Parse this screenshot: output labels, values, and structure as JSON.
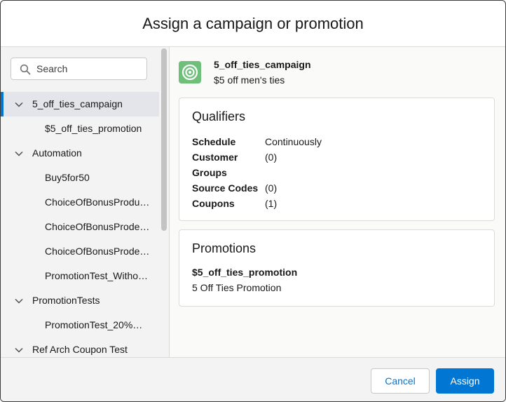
{
  "dialog": {
    "title": "Assign a campaign or promotion"
  },
  "search": {
    "placeholder": "Search"
  },
  "tree": {
    "items": [
      {
        "label": "5_off_ties_campaign",
        "level": 0,
        "expanded": true,
        "selected": true
      },
      {
        "label": "$5_off_ties_promotion",
        "level": 1
      },
      {
        "label": "Automation",
        "level": 0,
        "expanded": true
      },
      {
        "label": "Buy5for50",
        "level": 1
      },
      {
        "label": "ChoiceOfBonusProdu…",
        "level": 1
      },
      {
        "label": "ChoiceOfBonusProde…",
        "level": 1
      },
      {
        "label": "ChoiceOfBonusProde…",
        "level": 1
      },
      {
        "label": "PromotionTest_Witho…",
        "level": 1
      },
      {
        "label": "PromotionTests",
        "level": 0,
        "expanded": true
      },
      {
        "label": "PromotionTest_20%…",
        "level": 1
      },
      {
        "label": "Ref Arch Coupon Test",
        "level": 0,
        "expanded": true
      }
    ]
  },
  "detail": {
    "campaign_name": "5_off_ties_campaign",
    "campaign_description": "$5 off men's ties",
    "campaign_icon": "target-icon",
    "qualifiers": {
      "title": "Qualifiers",
      "rows": [
        {
          "key": "Schedule",
          "value": "Continuously"
        },
        {
          "key": "Customer",
          "value": "(0)"
        },
        {
          "key": "Groups",
          "value": ""
        },
        {
          "key": "Source Codes",
          "value": "(0)"
        },
        {
          "key": "Coupons",
          "value": "(1)"
        }
      ]
    },
    "promotions": {
      "title": "Promotions",
      "name": "$5_off_ties_promotion",
      "description": "5 Off Ties Promotion"
    }
  },
  "footer": {
    "cancel_label": "Cancel",
    "assign_label": "Assign"
  },
  "colors": {
    "brand": "#0176d3",
    "campaign_icon_bg": "#6ebf7a"
  }
}
